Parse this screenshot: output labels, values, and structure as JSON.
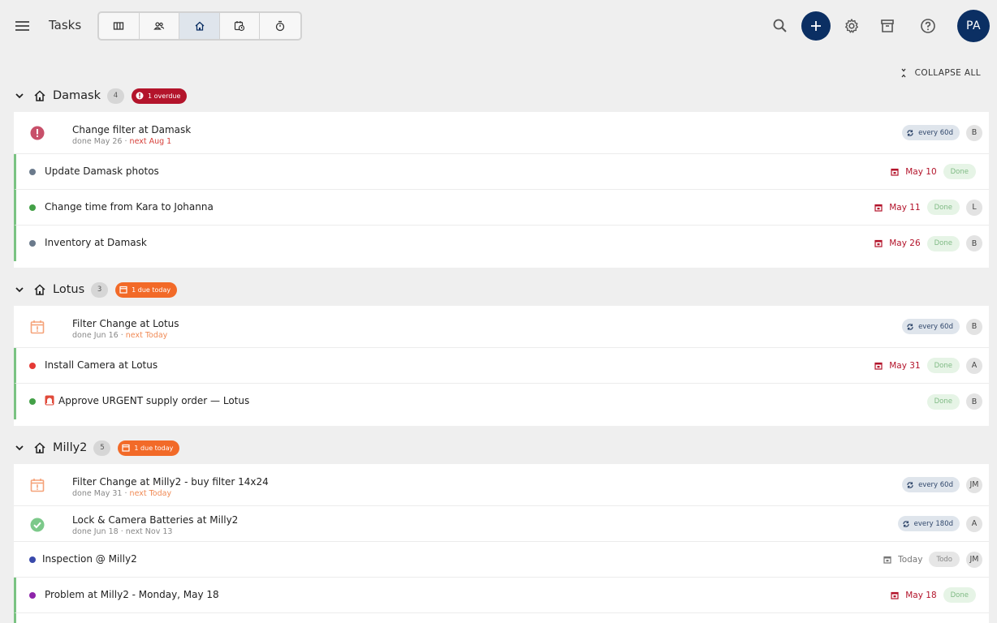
{
  "app": {
    "title": "Tasks"
  },
  "header": {
    "views": [
      {
        "name": "board-view",
        "icon": "columns-icon",
        "active": false
      },
      {
        "name": "people-view",
        "icon": "people-icon",
        "active": false
      },
      {
        "name": "property-view",
        "icon": "home-icon",
        "active": true
      },
      {
        "name": "calendar-view",
        "icon": "calendar-clock-icon",
        "active": false
      },
      {
        "name": "timer-view",
        "icon": "timer-icon",
        "active": false
      }
    ],
    "profile_initials": "PA",
    "accent": "#0b2f63"
  },
  "collapse_all_label": "COLLAPSE ALL",
  "groups": [
    {
      "name": "Damask",
      "count": "4",
      "status": "1 overdue",
      "status_color": "#b3142b",
      "rows": [
        {
          "title": "Change filter at Damask",
          "sub_done": "done May 26 · ",
          "sub_next": "next Aug 1",
          "repeat": "every 60d",
          "avatar": "B"
        },
        {
          "title": "Update Damask photos",
          "dot": "#6b7a8c",
          "date": "May 10",
          "state": "Done"
        },
        {
          "title": "Change time from Kara to Johanna",
          "dot": "#43a047",
          "date": "May 11",
          "state": "Done",
          "avatar": "L"
        },
        {
          "title": "Inventory at Damask",
          "dot": "#6b7a8c",
          "date": "May 26",
          "state": "Done",
          "avatar": "B"
        }
      ]
    },
    {
      "name": "Lotus",
      "count": "3",
      "status": "1 due today",
      "status_color": "#f26a28",
      "rows": [
        {
          "title": "Filter Change at Lotus",
          "sub_done": "done Jun 16 · ",
          "sub_next": "next Today",
          "repeat": "every 60d",
          "avatar": "B"
        },
        {
          "title": "Install Camera at Lotus",
          "dot": "#e53935",
          "date": "May 31",
          "state": "Done",
          "avatar": "A"
        },
        {
          "title": "Approve URGENT supply order — Lotus",
          "dot": "#43a047",
          "state": "Done",
          "avatar": "B"
        }
      ]
    },
    {
      "name": "Milly2",
      "count": "5",
      "status": "1 due today",
      "status_color": "#f26a28",
      "rows": [
        {
          "title": "Filter Change at Milly2 - buy filter 14x24",
          "sub_done": "done May 31 · ",
          "sub_next": "next Today",
          "repeat": "every 60d",
          "avatar": "JM"
        },
        {
          "title": "Lock & Camera Batteries at Milly2",
          "sub_done": "done Jun 18 · next Nov 13",
          "sub_next": "",
          "repeat": "every 180d",
          "avatar": "A"
        },
        {
          "title": "Inspection @ Milly2",
          "dot": "#3949ab",
          "date": "Today",
          "state": "Todo",
          "avatar": "JM"
        },
        {
          "title": "Problem at Milly2 - Monday, May 18",
          "dot": "#8e24aa",
          "date": "May 18",
          "state": "Done"
        }
      ]
    }
  ]
}
